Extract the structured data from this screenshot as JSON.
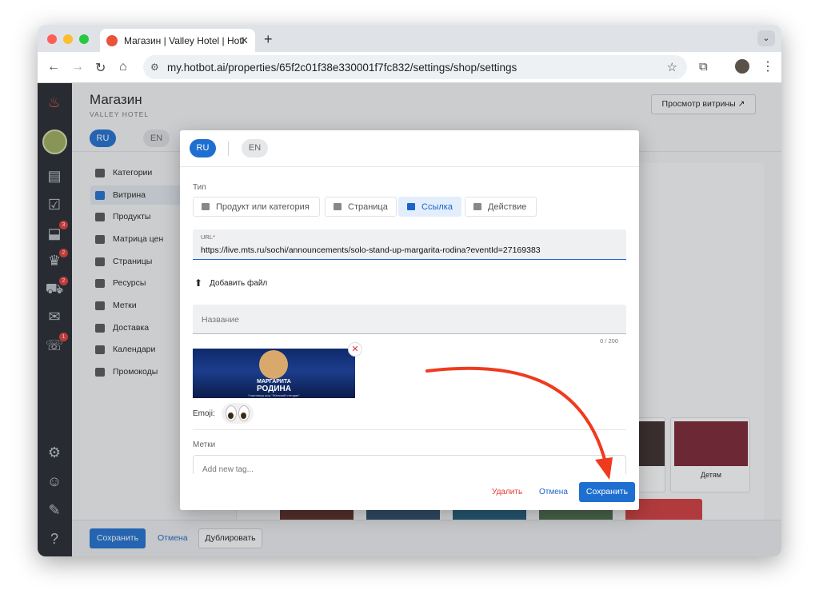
{
  "browser": {
    "tab_title": "Магазин | Valley Hotel | Hotbot",
    "new_tab_glyph": "+",
    "url": "my.hotbot.ai/properties/65f2c01f38e330001f7fc832/settings/shop/settings"
  },
  "header": {
    "title": "Магазин",
    "subtitle": "VALLEY HOTEL",
    "preview_label": "Просмотр витрины ↗"
  },
  "langs": [
    "RU",
    "EN"
  ],
  "rail": {
    "badges": [
      "3",
      "2",
      "2",
      "1"
    ]
  },
  "menu": [
    {
      "label": "Категории"
    },
    {
      "label": "Витрина"
    },
    {
      "label": "Продукты"
    },
    {
      "label": "Матрица цен"
    },
    {
      "label": "Страницы"
    },
    {
      "label": "Ресурсы"
    },
    {
      "label": "Метки"
    },
    {
      "label": "Доставка"
    },
    {
      "label": "Календари"
    },
    {
      "label": "Промокоды"
    }
  ],
  "showcase_card_label": "Детям",
  "bottom": {
    "save": "Сохранить",
    "cancel": "Отмена",
    "duplicate": "Дублировать"
  },
  "modal": {
    "langs": [
      "RU",
      "EN"
    ],
    "type_label": "Тип",
    "types": [
      "Продукт или категория",
      "Страница",
      "Ссылка",
      "Действие"
    ],
    "active_type": "Ссылка",
    "url_label": "URL",
    "url_required": "*",
    "url_value": "https://live.mts.ru/sochi/announcements/solo-stand-up-margarita-rodina?eventId=27169383",
    "add_file": "Добавить файл",
    "name_placeholder": "Название",
    "name_counter": "0 / 200",
    "banner": {
      "line1": "МАРГАРИТА",
      "line2": "РОДИНА",
      "line3": "Участница шоу \"Женский стендап\""
    },
    "emoji_label": "Emoji:",
    "tags_label": "Метки",
    "tags_placeholder": "Add new tag...",
    "delete": "Удалить",
    "cancel": "Отмена",
    "save": "Сохранить"
  },
  "colors": {
    "accent": "#1e6fd0",
    "danger": "#e53935",
    "annotation_arrow": "#f03a1e"
  }
}
